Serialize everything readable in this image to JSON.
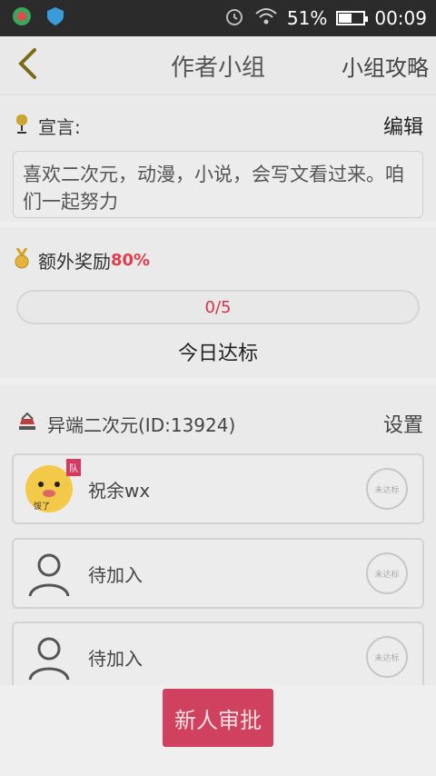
{
  "status_bar": {
    "battery": "51%",
    "time": "00:09",
    "icons": [
      "app-icon",
      "shield-icon",
      "alarm-icon",
      "wifi-icon",
      "battery-icon"
    ]
  },
  "header": {
    "title": "作者小组",
    "right_label": "小组攻略"
  },
  "motto": {
    "label": "宣言:",
    "edit_label": "编辑",
    "text": "喜欢二次元，动漫，小说，会写文看过来。咱们一起努力"
  },
  "reward": {
    "label": "额外奖励",
    "percent": "80%",
    "progress_text": "0/5",
    "progress_value": 0,
    "goal_label": "今日达标"
  },
  "group": {
    "name": "异端二次元(ID:13924)",
    "settings_label": "设置",
    "members": [
      {
        "name": "祝余wx",
        "avatar_label": "馁了",
        "badge": "队",
        "stamp": "未达标"
      },
      {
        "name": "待加入",
        "stamp": "未达标"
      },
      {
        "name": "待加入",
        "stamp": "未达标"
      }
    ]
  },
  "approve_button": "新人审批",
  "colors": {
    "accent": "#d0415f",
    "progress_text": "#d03548",
    "percent": "#e03c4a"
  }
}
